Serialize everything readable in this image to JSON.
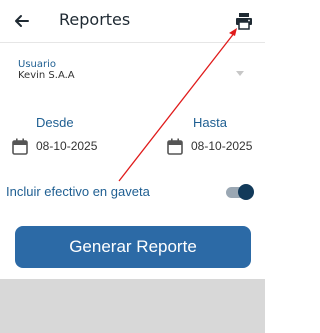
{
  "header": {
    "title": "Reportes",
    "back_icon": "arrow-left-icon",
    "print_icon": "printer-icon"
  },
  "form": {
    "user_label": "Usuario",
    "user_value": "Kevin S.A.A",
    "from_label": "Desde",
    "to_label": "Hasta",
    "from_date": "08-10-2025",
    "to_date": "08-10-2025",
    "include_cash_label": "Incluir efectivo en gaveta",
    "include_cash_on": true
  },
  "actions": {
    "generate_label": "Generar Reporte"
  },
  "colors": {
    "accent": "#2c6aa6",
    "label_blue": "#1f5f92",
    "annotation_red": "#e01b1b"
  }
}
